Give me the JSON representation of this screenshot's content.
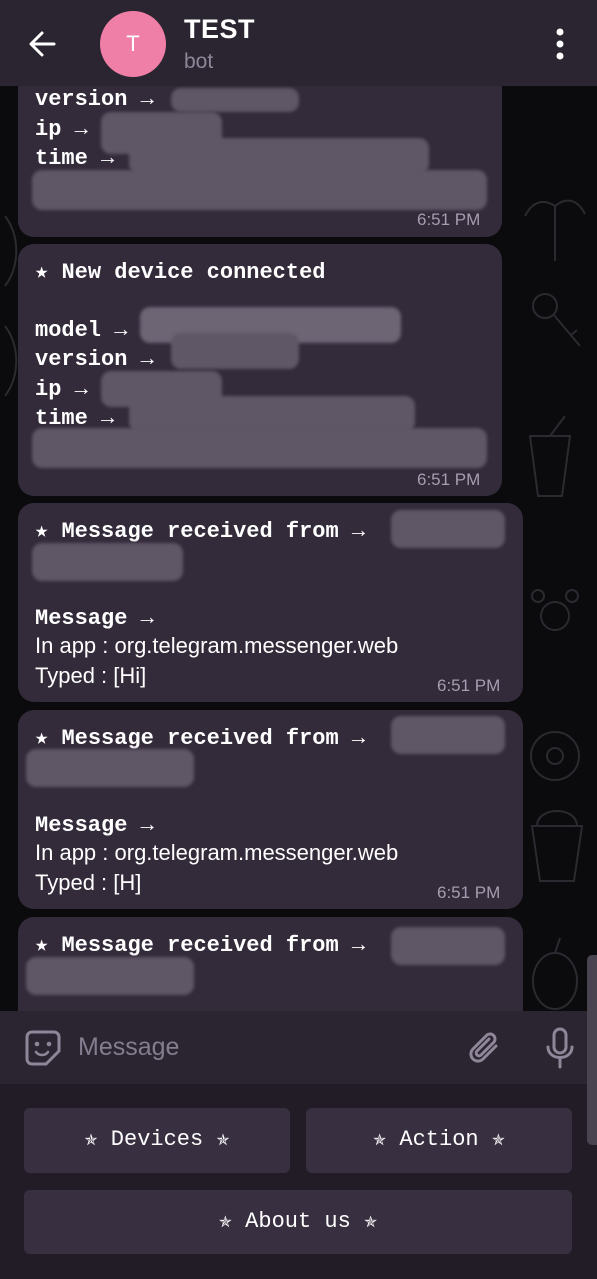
{
  "header": {
    "title": "TEST",
    "subtitle": "bot",
    "avatar_letter": "T",
    "avatar_color": "#ef7fa6"
  },
  "messages": [
    {
      "lines": [
        "version →",
        "ip →",
        "time →"
      ],
      "time": "6:51 PM"
    },
    {
      "title": "★ New device connected",
      "lines": [
        "model →",
        "version →",
        "ip →",
        "time →"
      ],
      "time": "6:51 PM"
    },
    {
      "title": "★ Message received from →",
      "message_label": "Message →",
      "app_line": "In app : org.telegram.messenger.web",
      "typed_line": "Typed : [Hi]",
      "time": "6:51 PM"
    },
    {
      "title": "★ Message received from →",
      "message_label": "Message →",
      "app_line": "In app : org.telegram.messenger.web",
      "typed_line": "Typed : [H]",
      "time": "6:51 PM"
    },
    {
      "title": "★ Message received from →"
    }
  ],
  "input": {
    "placeholder": "Message"
  },
  "keyboard": {
    "devices": "✯ Devices ✯",
    "action": "✯ Action ✯",
    "about": "✯ About us ✯"
  },
  "colors": {
    "header_bg": "#2b2532",
    "bubble_bg": "#332a3a",
    "keyboard_bg": "#221c27",
    "button_bg": "#382f40"
  }
}
